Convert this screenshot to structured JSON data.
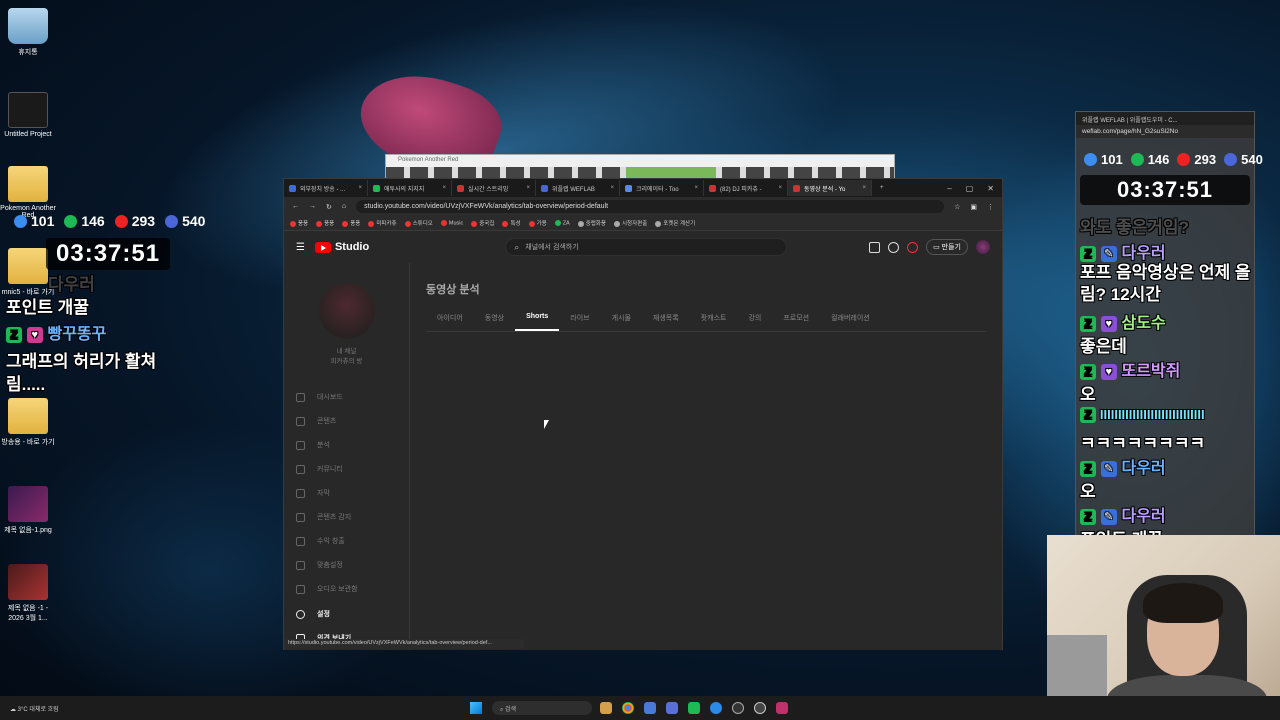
{
  "desktop": {
    "icons": [
      {
        "label": "휴지통"
      },
      {
        "label": "Untitled Project"
      },
      {
        "label": "Pokemon Another Red"
      },
      {
        "label": "mnic5 - 바로 가기"
      },
      {
        "label": "방송용 - 바로 가기"
      },
      {
        "label": "제목 없음-1.png"
      },
      {
        "label": "제목 없음 -1 - 2026 3월 1..."
      }
    ]
  },
  "stats": {
    "viewers_a": "101",
    "viewers_b": "146",
    "viewers_c": "293",
    "viewers_d": "540",
    "clock": "03:37:51"
  },
  "left_chat": {
    "faded_name": "다우러",
    "msg1": "포인트 개꿀",
    "name2": "빵꾸똥꾸",
    "msg2_line1": "그래프의 허리가 활쳐",
    "msg2_line2": "림....."
  },
  "pokemon_window": {
    "title": "Pokemon Another Red"
  },
  "browser": {
    "tabs": [
      {
        "label": "외부장치 방송 - ..."
      },
      {
        "label": "애투사의 지지지"
      },
      {
        "label": "실시간 스트리밍"
      },
      {
        "label": "위플랩 WEFLAB"
      },
      {
        "label": "크리에이터 - Too"
      },
      {
        "label": "(82) DJ 피카츄 -"
      },
      {
        "label": "동영상 분석 - Yo"
      }
    ],
    "url": "studio.youtube.com/video/UVzjVXFeWVk/analytics/tab-overview/period-default",
    "bookmarks": [
      "풍풍",
      "풍풍",
      "풍풍",
      "미피카츄",
      "스튜디오",
      "Music",
      "중국집",
      "특성",
      "가용",
      "ZA",
      "중랩화풍",
      "시청자편출",
      "포켓몬 계산기"
    ],
    "status_url": "https://studio.youtube.com/video/UVzjVXFeWVk/analytics/tab-overview/period-def..."
  },
  "studio": {
    "logo_text": "Studio",
    "search_placeholder": "채널에서 검색하기",
    "create_label": "만들기",
    "channel_label": "내 채널",
    "channel_sub": "피카츄의 방",
    "sidebar": [
      "대시보드",
      "콘텐츠",
      "분석",
      "커뮤니티",
      "자막",
      "콘텐츠 감지",
      "수익 창출",
      "맞춤설정",
      "오디오 보관함"
    ],
    "settings_label": "설정",
    "feedback_label": "의견 보내기",
    "page_title": "동영상 분석",
    "subtabs": [
      "아이디어",
      "동영상",
      "Shorts",
      "라이브",
      "게시물",
      "재생목록",
      "팟캐스트",
      "강의",
      "프로모션",
      "컬래버레이션"
    ],
    "active_subtab": "Shorts"
  },
  "weflab": {
    "title": "위플랩 WEFLAB | 위플랩도우미 - C...",
    "url": "weflab.com/page/hN_G2suSl2No",
    "clock": "03:37:51",
    "faded_top": "와도 좋은거임?",
    "chat": [
      {
        "name": "다우러",
        "msg": "포프 음악영상은 언제 올림? 12시간"
      },
      {
        "name": "삼도수",
        "msg": "좋은데"
      },
      {
        "name": "또르박쥐",
        "msg": "오"
      },
      {
        "name": "IIIIIIIIIIIIIIIIIIIIIIIIIIIII",
        "msg": "ㅋㅋㅋㅋㅋㅋㅋㅋ"
      },
      {
        "name": "다우러",
        "msg": "오"
      },
      {
        "name": "다우러",
        "msg": "포인트 개꿀"
      }
    ]
  },
  "taskbar": {
    "weather_temp": "3°C",
    "weather_desc": "대체로 흐림",
    "search": "검색"
  }
}
